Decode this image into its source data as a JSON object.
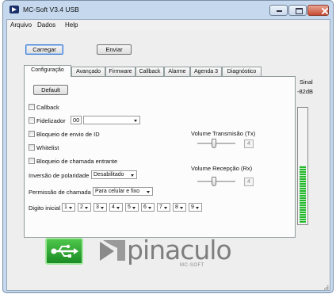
{
  "window": {
    "title": "MC-Soft V3.4 USB"
  },
  "menu": [
    "Arquivo",
    "Dados",
    "Help"
  ],
  "toolbar": {
    "load": "Carregar",
    "send": "Enviar"
  },
  "tabs": [
    "Configuração",
    "Avançado",
    "Firmware",
    "Callback",
    "Alarme",
    "Agenda 3",
    "Diagnóstico"
  ],
  "config": {
    "default_button": "Default",
    "checkboxes": {
      "callback": "Callback",
      "fidelizador": "Fidelizador",
      "bloqueio_envio": "Bloqueio de envio de ID",
      "whitelist": "Whitelist",
      "bloqueio_chamada": "Bloqueio de chamada entrante"
    },
    "fidelizador_value": "00",
    "fidelizador_select": "",
    "volume_tx": {
      "label": "Volume Transmisão (Tx)",
      "value": "4"
    },
    "volume_rx": {
      "label": "Volume Recepção (Rx)",
      "value": "4"
    },
    "inversao": {
      "label": "Inversão de polaridade",
      "value": "Desabilitado"
    },
    "permissao": {
      "label": "Permissão de chamada",
      "value": "Para celular e fixo"
    },
    "digito": {
      "label": "Digito inicial",
      "values": [
        "1",
        "2",
        "3",
        "4",
        "5",
        "6",
        "7",
        "8",
        "9"
      ]
    }
  },
  "signal": {
    "label": "Sinal",
    "value": "-82dB",
    "level_fraction": 0.5
  },
  "branding": {
    "logo_word": "pinaculo",
    "logo_sub": "MC-SOFT"
  },
  "colors": {
    "accent": "#3a7bd5",
    "meter": "#25b72e",
    "usb": "#1f9a2a"
  }
}
